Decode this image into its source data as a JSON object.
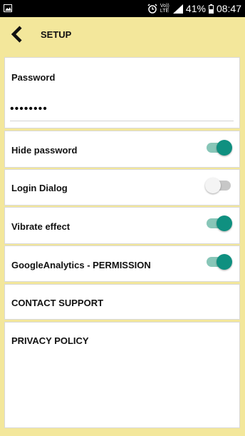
{
  "status_bar": {
    "battery": "41%",
    "time": "08:47",
    "network": "Vo)) LTE"
  },
  "header": {
    "title": "SETUP"
  },
  "password": {
    "label": "Password",
    "value": "••••••••"
  },
  "settings": [
    {
      "label": "Hide password",
      "toggle": true
    },
    {
      "label": "Login Dialog",
      "toggle": false
    },
    {
      "label": "Vibrate effect",
      "toggle": true
    },
    {
      "label": "GoogleAnalytics - PERMISSION",
      "toggle": true
    }
  ],
  "links": {
    "contact_support": "CONTACT SUPPORT",
    "privacy_policy": "PRIVACY POLICY"
  },
  "colors": {
    "background": "#f3e79b",
    "toggle_on": "#0f9080",
    "toggle_on_track": "#88c6b8",
    "toggle_off_track": "#c7c7c7"
  }
}
